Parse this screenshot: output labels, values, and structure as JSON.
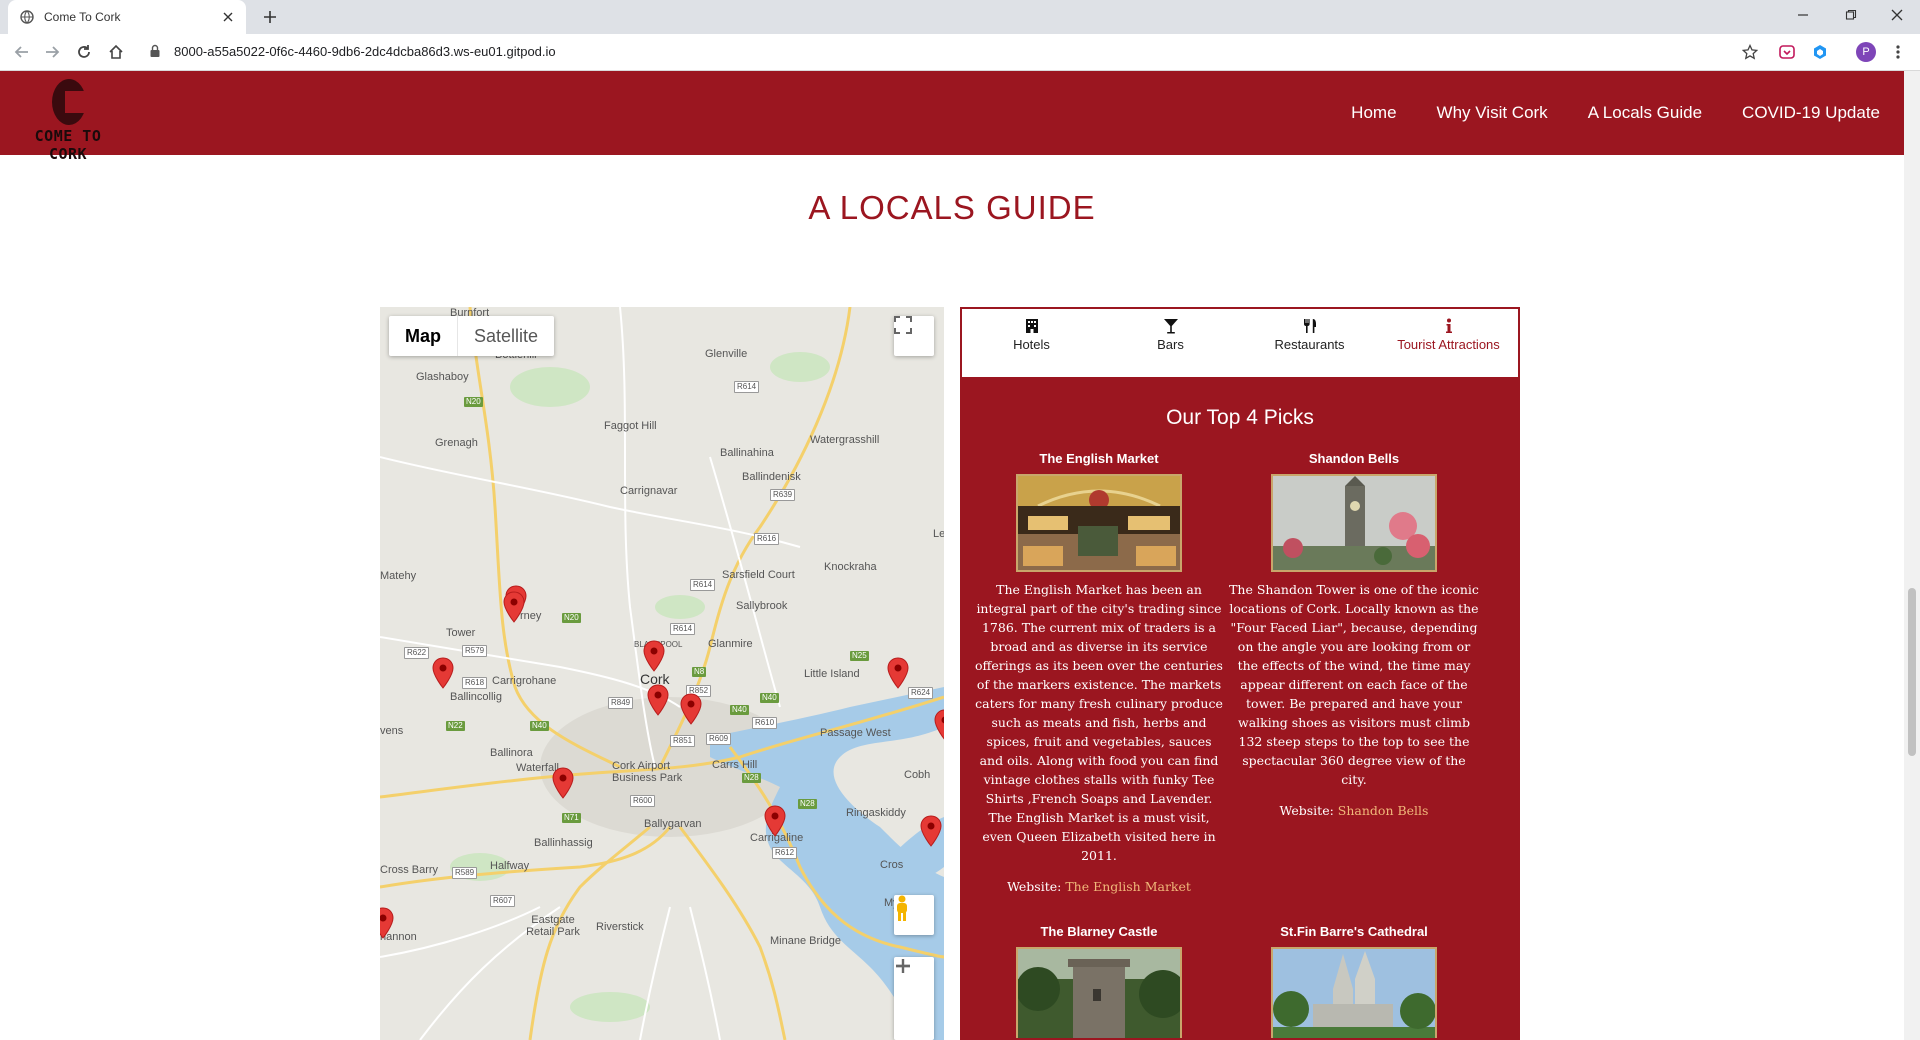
{
  "browser": {
    "tab_title": "Come To Cork",
    "url": "8000-a55a5022-0f6c-4460-9db6-2dc4dcba86d3.ws-eu01.gitpod.io",
    "avatar_letter": "P"
  },
  "site": {
    "logo_text": "COME TO CORK",
    "nav": [
      "Home",
      "Why Visit Cork",
      "A Locals Guide",
      "COVID-19 Update"
    ],
    "heading": "A LOCALS GUIDE"
  },
  "map": {
    "type_buttons": [
      "Map",
      "Satellite"
    ],
    "labels": {
      "burnfort": "Burnfort",
      "bottlehill": "Bottlehill",
      "glashaboy": "Glashaboy",
      "glenville": "Glenville",
      "grenagh": "Grenagh",
      "faggot_hill": "Faggot Hill",
      "ballinahina": "Ballinahina",
      "watergrasshill": "Watergrasshill",
      "ballindenisk": "Ballindenisk",
      "carrignavar": "Carrignavar",
      "le": "Le",
      "matehy": "Matehy",
      "knockraha": "Knockraha",
      "sarsfield_court": "Sarsfield Court",
      "sallybrook": "Sallybrook",
      "blarney": "rney",
      "tower": "Tower",
      "glanmire": "Glanmire",
      "cork": "Cork",
      "blackpool": "BLACKPOOL",
      "carrigrohane": "Carrigrohane",
      "ballincollig": "Ballincollig",
      "little_island": "Little Island",
      "ovens": "vens",
      "passage_west": "Passage West",
      "ballinora": "Ballinora",
      "waterfall": "Waterfall",
      "cork_airport": "Cork Airport Business Park",
      "carrs_hill": "Carrs Hill",
      "cobh": "Cobh",
      "ringaskiddy": "Ringaskiddy",
      "ballygarvan": "Ballygarvan",
      "carrigaline": "Carrigaline",
      "ballinhassig": "Ballinhassig",
      "cross_barry": "Cross Barry",
      "halfway": "Halfway",
      "cros": "Cros",
      "eastgate": "Eastgate Retail Park",
      "riverstick": "Riverstick",
      "minane_bridge": "Minane Bridge",
      "shannon": "hannon",
      "myrtleville": "Myrtleville"
    },
    "roads": [
      "N20",
      "R614",
      "R639",
      "R616",
      "R614",
      "N20",
      "R614",
      "R622",
      "R579",
      "R618",
      "R852",
      "N8",
      "N25",
      "R624",
      "R849",
      "N40",
      "N22",
      "N40",
      "R851",
      "R609",
      "R610",
      "N40",
      "N28",
      "R600",
      "N28",
      "N71",
      "R612",
      "R589",
      "R607"
    ]
  },
  "guide": {
    "tabs": [
      {
        "icon": "hotel-icon",
        "label": "Hotels"
      },
      {
        "icon": "cocktail-icon",
        "label": "Bars"
      },
      {
        "icon": "utensils-icon",
        "label": "Restaurants"
      },
      {
        "icon": "info-icon",
        "label": "Tourist Attractions"
      }
    ],
    "title": "Our Top 4 Picks",
    "website_prefix": "Website:",
    "picks": [
      {
        "name": "The English Market",
        "description": "The English Market has been an integral part of the city's trading since 1786. The current mix of traders is a broad and as diverse in its service offerings as its been over the centuries of the markers existence. The markets caters for many fresh culinary produce such as meats and fish, herbs and spices, fruit and vegetables, sauces and oils. Along with food you can find vintage clothes stalls with funky Tee Shirts ,French Soaps and Lavender. The English Market is a must visit, even Queen Elizabeth visited here in 2011.",
        "link": "The English Market"
      },
      {
        "name": "Shandon Bells",
        "description": "The Shandon Tower is one of the iconic locations of Cork. Locally known as the \"Four Faced Liar\", because, depending on the angle you are looking from or the effects of the wind, the time may appear different on each face of the tower. Be prepared and have your walking shoes as visitors must climb 132 steep steps to the top to see the spectacular 360 degree view of the city.",
        "link": "Shandon Bells"
      },
      {
        "name": "The Blarney Castle"
      },
      {
        "name": "St.Fin Barre's Cathedral"
      }
    ]
  }
}
